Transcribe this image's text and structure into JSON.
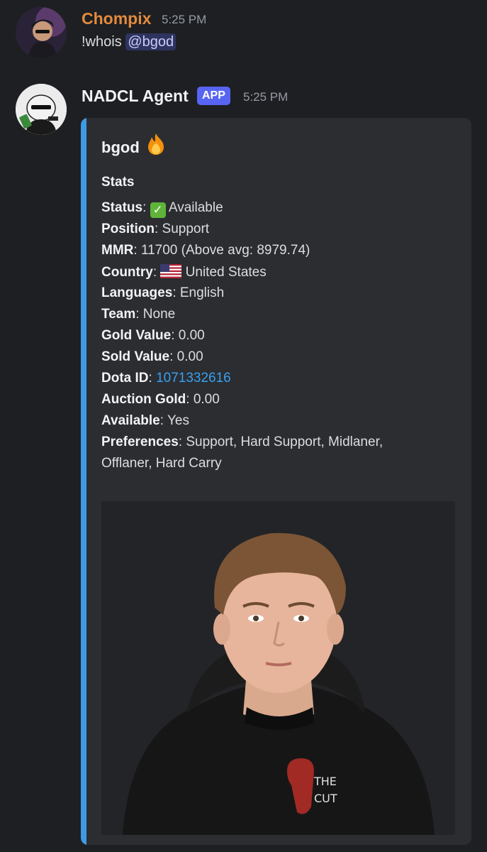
{
  "message1": {
    "author": "Chompix",
    "author_color": "#e38a3e",
    "timestamp": "5:25 PM",
    "text": "!whois",
    "mention": "@bgod"
  },
  "message2": {
    "author": "NADCL Agent",
    "badge": "APP",
    "timestamp": "5:25 PM",
    "embed": {
      "accent_color": "#3e9ae3",
      "title": "bgod",
      "title_icon": "fire-icon",
      "section_title": "Stats",
      "stats": [
        {
          "label": "Status",
          "sep": ":",
          "value": "Available",
          "icon": "check-mark-icon"
        },
        {
          "label": "Position",
          "sep": ":",
          "value": "Support"
        },
        {
          "label": "MMR",
          "sep": ":",
          "value": "11700 (Above avg: 8979.74)"
        },
        {
          "label": "Country",
          "sep": ":",
          "value": "United States",
          "icon": "us-flag-icon"
        },
        {
          "label": "Languages",
          "sep": ":",
          "value": "English"
        },
        {
          "label": "Team",
          "sep": ":",
          "value": "None"
        },
        {
          "label": "Gold Value",
          "sep": ":",
          "value": "0.00"
        },
        {
          "label": "Sold Value",
          "sep": ":",
          "value": "0.00"
        },
        {
          "label": "Dota ID",
          "sep": ":",
          "value": "1071332616",
          "is_link": true
        },
        {
          "label": "Auction Gold",
          "sep": ":",
          "value": "0.00"
        },
        {
          "label": "Available",
          "sep": ":",
          "value": "Yes"
        },
        {
          "label": "Preferences",
          "sep": ":",
          "value": "Support, Hard Support, Midlaner,",
          "value_cont": "Offlaner, Hard Carry"
        }
      ],
      "image_icon": "player-photo"
    }
  }
}
